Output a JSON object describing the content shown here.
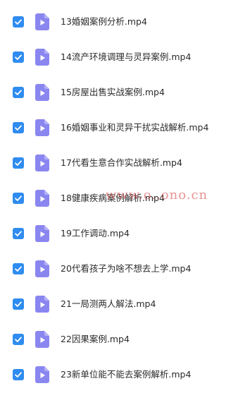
{
  "colors": {
    "checkbox": "#2f8cf0",
    "video_icon": "#8a86f0",
    "text": "#2b2b2b",
    "watermark": "#d23c3c"
  },
  "icons": {
    "checkbox": "checkbox-checked-icon",
    "file": "video-file-icon"
  },
  "files": [
    {
      "name": "13婚姻案例分析.mp4",
      "checked": true
    },
    {
      "name": "14流产环境调理与灵异案例.mp4",
      "checked": true
    },
    {
      "name": "15房屋出售实战案例.mp4",
      "checked": true
    },
    {
      "name": "16婚姻事业和灵异干扰实战解析.mp4",
      "checked": true
    },
    {
      "name": "17代看生意合作实战解析.mp4",
      "checked": true
    },
    {
      "name": "18健康疾病案例解析.mp4",
      "checked": true
    },
    {
      "name": "19工作调动.mp4",
      "checked": true
    },
    {
      "name": "20代看孩子为啥不想去上学.mp4",
      "checked": true
    },
    {
      "name": "21一局测两人解法.mp4",
      "checked": true
    },
    {
      "name": "22因果案例.mp4",
      "checked": true
    },
    {
      "name": "23新单位能不能去案例解析.mp4",
      "checked": true
    }
  ],
  "watermark": "www.o..ono.cn"
}
